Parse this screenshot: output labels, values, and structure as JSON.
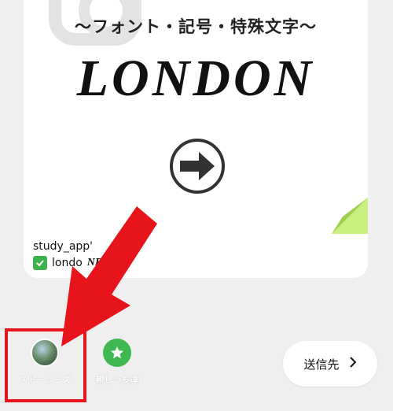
{
  "post": {
    "subtitle": "〜フォント・記号・特殊文字〜",
    "headline": "LONDON",
    "account": "study_app'",
    "caption_prefix": "londo",
    "caption_suffix": "NDON..."
  },
  "share": {
    "stories_label": "ストーリーズ",
    "close_friends_label": "親しい友達",
    "send_label": "送信先",
    "send_chevron": "›"
  },
  "colors": {
    "highlight_red": "#e8141b",
    "close_friends_green": "#3fb851"
  }
}
